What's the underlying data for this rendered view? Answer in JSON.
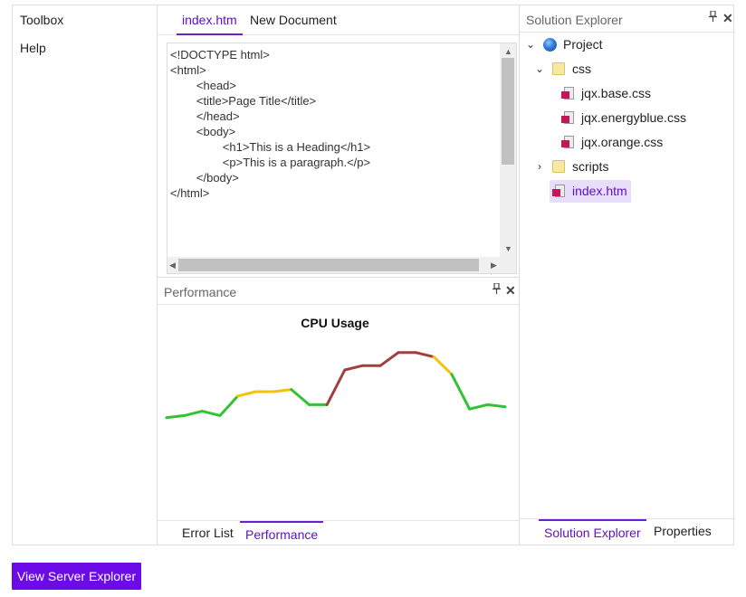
{
  "left_panel": {
    "items": [
      {
        "label": "Toolbox"
      },
      {
        "label": "Help"
      }
    ]
  },
  "document_tabs": [
    {
      "label": "index.htm",
      "active": true
    },
    {
      "label": "New Document",
      "active": false
    }
  ],
  "editor": {
    "code": "<!DOCTYPE html>\n<html>\n        <head>\n        <title>Page Title</title>\n        </head>\n        <body>\n                <h1>This is a Heading</h1>\n                <p>This is a paragraph.</p>\n        </body>\n</html>"
  },
  "performance_panel": {
    "title": "Performance",
    "pin_icon": "pin-icon",
    "close_icon": "close-icon"
  },
  "chart_data": {
    "type": "line",
    "title": "CPU Usage",
    "xlabel": "",
    "ylabel": "",
    "grid": false,
    "ylim": [
      0,
      100
    ],
    "x": [
      0,
      1,
      2,
      3,
      4,
      5,
      6,
      7,
      8,
      9,
      10,
      11,
      12,
      13,
      14,
      15,
      16,
      17,
      18,
      19
    ],
    "values": [
      48,
      49,
      51,
      49,
      58,
      60,
      60,
      61,
      54,
      54,
      70,
      72,
      72,
      78,
      78,
      76,
      68,
      52,
      54,
      53
    ],
    "segment_colors": [
      "#33c233",
      "#33c233",
      "#33c233",
      "#33c233",
      "#f5c20b",
      "#f5c20b",
      "#f5c20b",
      "#33c233",
      "#33c233",
      "#a0403c",
      "#a0403c",
      "#a0403c",
      "#a0403c",
      "#a0403c",
      "#a0403c",
      "#f5c20b",
      "#33c233",
      "#33c233",
      "#33c233"
    ],
    "colors": {
      "low": "#33c233",
      "medium": "#f5c20b",
      "high": "#a0403c"
    }
  },
  "bottom_tabs_middle": [
    {
      "label": "Error List",
      "active": false
    },
    {
      "label": "Performance",
      "active": true
    }
  ],
  "solution_explorer": {
    "title": "Solution Explorer",
    "pin_icon": "pin-icon",
    "close_icon": "close-icon",
    "tree": {
      "project": "Project",
      "css_folder": "css",
      "css_files": [
        "jqx.base.css",
        "jqx.energyblue.css",
        "jqx.orange.css"
      ],
      "scripts_folder": "scripts",
      "index_file": "index.htm"
    }
  },
  "bottom_tabs_right": [
    {
      "label": "Solution Explorer",
      "active": true
    },
    {
      "label": "Properties",
      "active": false
    }
  ],
  "view_server_button": "View Server Explorer",
  "accent_color": "#6c0be8"
}
